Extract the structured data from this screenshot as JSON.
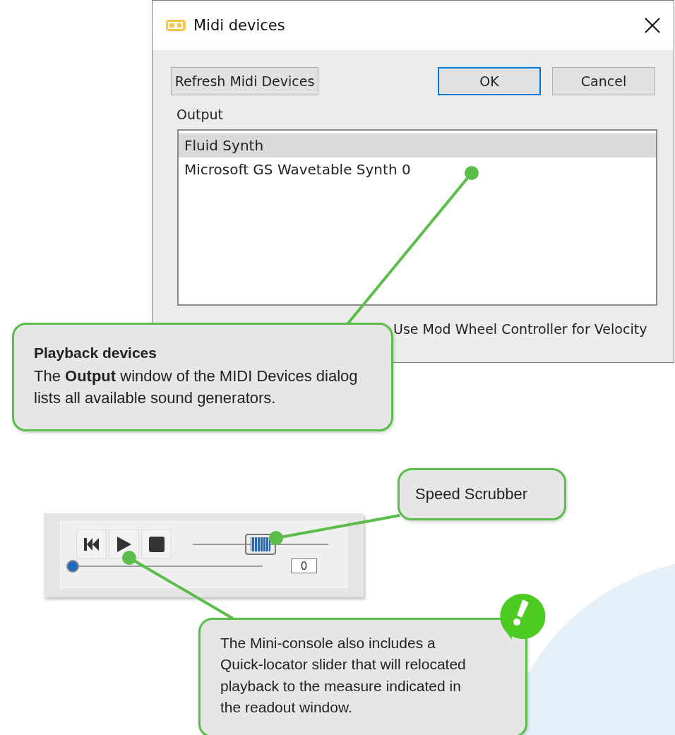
{
  "dialog": {
    "title": "Midi devices",
    "buttons": [
      {
        "label": "Refresh Midi Devices",
        "focused": false
      },
      {
        "label": "OK",
        "focused": true
      },
      {
        "label": "Cancel",
        "focused": false
      }
    ],
    "output_label": "Output",
    "output_devices": [
      {
        "name": "Fluid Synth",
        "selected": true
      },
      {
        "name": "Microsoft GS Wavetable Synth 0",
        "selected": false
      }
    ],
    "mod_wheel_option": {
      "label": "Use Mod Wheel Controller for Velocity"
    }
  },
  "mini_console": {
    "speed_scrubber": {
      "level": 0.5
    },
    "quick_locator": {
      "level": 0
    },
    "measure_readout": "0"
  },
  "callouts": [
    {
      "title": "Playback devices",
      "text": "The **Output** window of the MIDI Devices dialog lists all available sound generators.",
      "alert": false
    },
    {
      "text": "Speed Scrubber",
      "alert": false
    },
    {
      "text": "The Mini-console also includes a Quick-locator slider that will relocated playback to the measure indicated in the readout window.",
      "alert": true
    }
  ]
}
